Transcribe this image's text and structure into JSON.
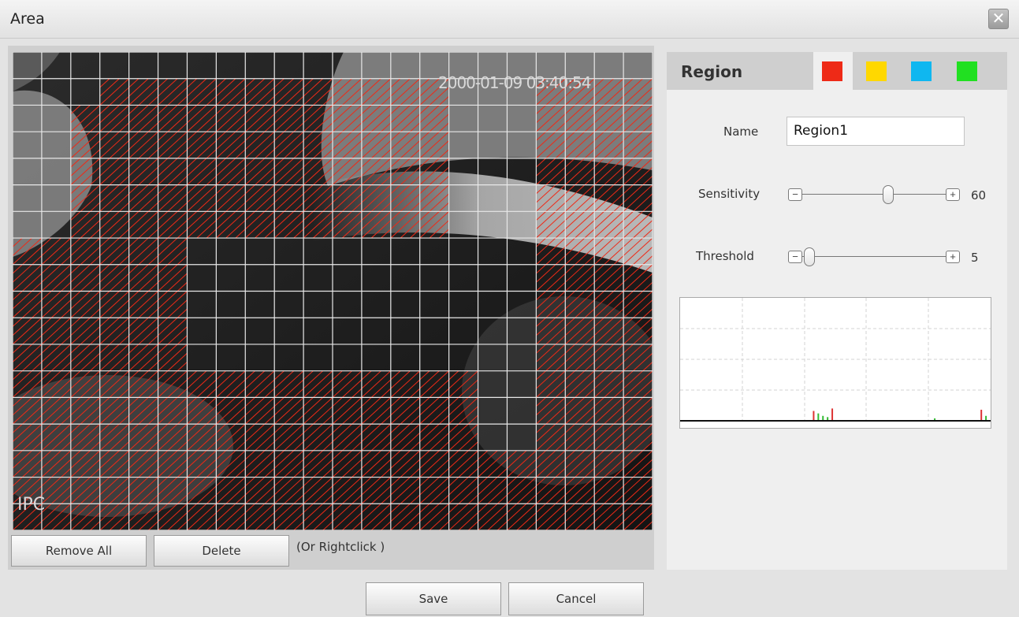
{
  "window": {
    "title": "Area",
    "close_glyph": "✕"
  },
  "video": {
    "timestamp": "2000-01-09 03:40:54",
    "channel_label": "IPC",
    "grid": {
      "cols": 22,
      "rows": 18
    },
    "selected_cells": [
      [
        1,
        3
      ],
      [
        1,
        4
      ],
      [
        1,
        5
      ],
      [
        1,
        6
      ],
      [
        1,
        7
      ],
      [
        1,
        8
      ],
      [
        1,
        9
      ],
      [
        1,
        10
      ],
      [
        1,
        11
      ],
      [
        1,
        12
      ],
      [
        1,
        13
      ],
      [
        1,
        14
      ],
      [
        1,
        18
      ],
      [
        1,
        19
      ],
      [
        1,
        20
      ],
      [
        1,
        21
      ],
      [
        2,
        2
      ],
      [
        2,
        3
      ],
      [
        2,
        4
      ],
      [
        2,
        5
      ],
      [
        2,
        6
      ],
      [
        2,
        7
      ],
      [
        2,
        8
      ],
      [
        2,
        9
      ],
      [
        2,
        10
      ],
      [
        2,
        11
      ],
      [
        2,
        12
      ],
      [
        2,
        13
      ],
      [
        2,
        14
      ],
      [
        2,
        18
      ],
      [
        2,
        19
      ],
      [
        2,
        20
      ],
      [
        2,
        21
      ],
      [
        3,
        2
      ],
      [
        3,
        3
      ],
      [
        3,
        4
      ],
      [
        3,
        5
      ],
      [
        3,
        6
      ],
      [
        3,
        7
      ],
      [
        3,
        8
      ],
      [
        3,
        9
      ],
      [
        3,
        10
      ],
      [
        3,
        11
      ],
      [
        3,
        12
      ],
      [
        3,
        13
      ],
      [
        3,
        14
      ],
      [
        3,
        18
      ],
      [
        3,
        19
      ],
      [
        3,
        20
      ],
      [
        3,
        21
      ],
      [
        4,
        2
      ],
      [
        4,
        3
      ],
      [
        4,
        4
      ],
      [
        4,
        5
      ],
      [
        4,
        6
      ],
      [
        4,
        7
      ],
      [
        4,
        8
      ],
      [
        4,
        9
      ],
      [
        4,
        10
      ],
      [
        4,
        11
      ],
      [
        4,
        12
      ],
      [
        4,
        13
      ],
      [
        4,
        14
      ],
      [
        4,
        18
      ],
      [
        4,
        19
      ],
      [
        4,
        20
      ],
      [
        4,
        21
      ],
      [
        5,
        2
      ],
      [
        5,
        3
      ],
      [
        5,
        4
      ],
      [
        5,
        5
      ],
      [
        5,
        6
      ],
      [
        5,
        7
      ],
      [
        5,
        8
      ],
      [
        5,
        9
      ],
      [
        5,
        10
      ],
      [
        5,
        11
      ],
      [
        5,
        12
      ],
      [
        5,
        13
      ],
      [
        5,
        14
      ],
      [
        5,
        18
      ],
      [
        5,
        19
      ],
      [
        5,
        20
      ],
      [
        5,
        21
      ],
      [
        6,
        2
      ],
      [
        6,
        3
      ],
      [
        6,
        4
      ],
      [
        6,
        5
      ],
      [
        6,
        6
      ],
      [
        6,
        7
      ],
      [
        6,
        8
      ],
      [
        6,
        9
      ],
      [
        6,
        10
      ],
      [
        6,
        11
      ],
      [
        6,
        12
      ],
      [
        6,
        13
      ],
      [
        6,
        14
      ],
      [
        6,
        18
      ],
      [
        6,
        19
      ],
      [
        6,
        20
      ],
      [
        6,
        21
      ],
      [
        7,
        0
      ],
      [
        7,
        1
      ],
      [
        7,
        2
      ],
      [
        7,
        3
      ],
      [
        7,
        4
      ],
      [
        7,
        5
      ],
      [
        7,
        18
      ],
      [
        7,
        19
      ],
      [
        7,
        20
      ],
      [
        7,
        21
      ],
      [
        8,
        0
      ],
      [
        8,
        1
      ],
      [
        8,
        2
      ],
      [
        8,
        3
      ],
      [
        8,
        4
      ],
      [
        8,
        5
      ],
      [
        8,
        18
      ],
      [
        8,
        19
      ],
      [
        8,
        20
      ],
      [
        8,
        21
      ],
      [
        9,
        0
      ],
      [
        9,
        1
      ],
      [
        9,
        2
      ],
      [
        9,
        3
      ],
      [
        9,
        4
      ],
      [
        9,
        5
      ],
      [
        9,
        18
      ],
      [
        9,
        19
      ],
      [
        9,
        20
      ],
      [
        9,
        21
      ],
      [
        10,
        0
      ],
      [
        10,
        1
      ],
      [
        10,
        2
      ],
      [
        10,
        3
      ],
      [
        10,
        4
      ],
      [
        10,
        5
      ],
      [
        10,
        18
      ],
      [
        10,
        19
      ],
      [
        10,
        20
      ],
      [
        10,
        21
      ],
      [
        11,
        0
      ],
      [
        11,
        1
      ],
      [
        11,
        2
      ],
      [
        11,
        3
      ],
      [
        11,
        4
      ],
      [
        11,
        5
      ],
      [
        11,
        18
      ],
      [
        11,
        19
      ],
      [
        11,
        20
      ],
      [
        11,
        21
      ],
      [
        12,
        0
      ],
      [
        12,
        1
      ],
      [
        12,
        2
      ],
      [
        12,
        3
      ],
      [
        12,
        4
      ],
      [
        12,
        5
      ],
      [
        12,
        6
      ],
      [
        12,
        7
      ],
      [
        12,
        8
      ],
      [
        12,
        9
      ],
      [
        12,
        10
      ],
      [
        12,
        11
      ],
      [
        12,
        12
      ],
      [
        12,
        13
      ],
      [
        12,
        14
      ],
      [
        12,
        15
      ],
      [
        12,
        18
      ],
      [
        12,
        19
      ],
      [
        12,
        20
      ],
      [
        12,
        21
      ],
      [
        13,
        0
      ],
      [
        13,
        1
      ],
      [
        13,
        2
      ],
      [
        13,
        3
      ],
      [
        13,
        4
      ],
      [
        13,
        5
      ],
      [
        13,
        6
      ],
      [
        13,
        7
      ],
      [
        13,
        8
      ],
      [
        13,
        9
      ],
      [
        13,
        10
      ],
      [
        13,
        11
      ],
      [
        13,
        12
      ],
      [
        13,
        13
      ],
      [
        13,
        14
      ],
      [
        13,
        15
      ],
      [
        13,
        18
      ],
      [
        13,
        19
      ],
      [
        13,
        20
      ],
      [
        13,
        21
      ],
      [
        14,
        0
      ],
      [
        14,
        1
      ],
      [
        14,
        2
      ],
      [
        14,
        3
      ],
      [
        14,
        4
      ],
      [
        14,
        5
      ],
      [
        14,
        6
      ],
      [
        14,
        7
      ],
      [
        14,
        8
      ],
      [
        14,
        9
      ],
      [
        14,
        10
      ],
      [
        14,
        11
      ],
      [
        14,
        12
      ],
      [
        14,
        13
      ],
      [
        14,
        14
      ],
      [
        14,
        15
      ],
      [
        14,
        18
      ],
      [
        14,
        19
      ],
      [
        14,
        20
      ],
      [
        14,
        21
      ],
      [
        15,
        0
      ],
      [
        15,
        1
      ],
      [
        15,
        2
      ],
      [
        15,
        3
      ],
      [
        15,
        4
      ],
      [
        15,
        5
      ],
      [
        15,
        6
      ],
      [
        15,
        7
      ],
      [
        15,
        8
      ],
      [
        15,
        9
      ],
      [
        15,
        10
      ],
      [
        15,
        11
      ],
      [
        15,
        12
      ],
      [
        15,
        13
      ],
      [
        15,
        14
      ],
      [
        15,
        15
      ],
      [
        15,
        16
      ],
      [
        15,
        17
      ],
      [
        15,
        18
      ],
      [
        15,
        19
      ],
      [
        15,
        20
      ],
      [
        15,
        21
      ],
      [
        16,
        0
      ],
      [
        16,
        1
      ],
      [
        16,
        2
      ],
      [
        16,
        3
      ],
      [
        16,
        4
      ],
      [
        16,
        5
      ],
      [
        16,
        6
      ],
      [
        16,
        7
      ],
      [
        16,
        8
      ],
      [
        16,
        9
      ],
      [
        16,
        10
      ],
      [
        16,
        11
      ],
      [
        16,
        12
      ],
      [
        16,
        13
      ],
      [
        16,
        14
      ],
      [
        16,
        15
      ],
      [
        16,
        16
      ],
      [
        16,
        17
      ],
      [
        16,
        18
      ],
      [
        16,
        19
      ],
      [
        16,
        20
      ],
      [
        16,
        21
      ],
      [
        17,
        0
      ],
      [
        17,
        1
      ],
      [
        17,
        2
      ],
      [
        17,
        3
      ],
      [
        17,
        4
      ],
      [
        17,
        5
      ],
      [
        17,
        6
      ],
      [
        17,
        7
      ],
      [
        17,
        8
      ],
      [
        17,
        9
      ],
      [
        17,
        10
      ],
      [
        17,
        11
      ],
      [
        17,
        12
      ],
      [
        17,
        13
      ],
      [
        17,
        14
      ],
      [
        17,
        15
      ],
      [
        17,
        16
      ],
      [
        17,
        17
      ],
      [
        17,
        18
      ],
      [
        17,
        19
      ],
      [
        17,
        20
      ],
      [
        17,
        21
      ]
    ]
  },
  "actions": {
    "remove_all": "Remove All",
    "delete": "Delete",
    "hint": "(Or Rightclick )"
  },
  "footer": {
    "save": "Save",
    "cancel": "Cancel"
  },
  "region_panel": {
    "tab_label": "Region",
    "region_colors": [
      "#ee2a17",
      "#ffd800",
      "#0fb7f0",
      "#21e021"
    ],
    "active_region_index": 0,
    "name_label": "Name",
    "name_value": "Region1",
    "sensitivity": {
      "label": "Sensitivity",
      "value": 60,
      "min": 0,
      "max": 100,
      "display": "60"
    },
    "threshold": {
      "label": "Threshold",
      "value": 5,
      "min": 0,
      "max": 100,
      "display": "5"
    }
  },
  "motion_graph": {
    "grid_lines": {
      "vertical": 4,
      "horizontal": 3
    },
    "spikes": [
      {
        "x": 0.43,
        "level": 0.08,
        "color": "#d33"
      },
      {
        "x": 0.445,
        "level": 0.06,
        "color": "#3b3"
      },
      {
        "x": 0.46,
        "level": 0.04,
        "color": "#3b3"
      },
      {
        "x": 0.475,
        "level": 0.03,
        "color": "#3b3"
      },
      {
        "x": 0.49,
        "level": 0.1,
        "color": "#d33"
      },
      {
        "x": 0.82,
        "level": 0.02,
        "color": "#3b3"
      },
      {
        "x": 0.97,
        "level": 0.09,
        "color": "#d33"
      },
      {
        "x": 0.985,
        "level": 0.04,
        "color": "#3b3"
      }
    ],
    "baseline_color": "#111"
  }
}
